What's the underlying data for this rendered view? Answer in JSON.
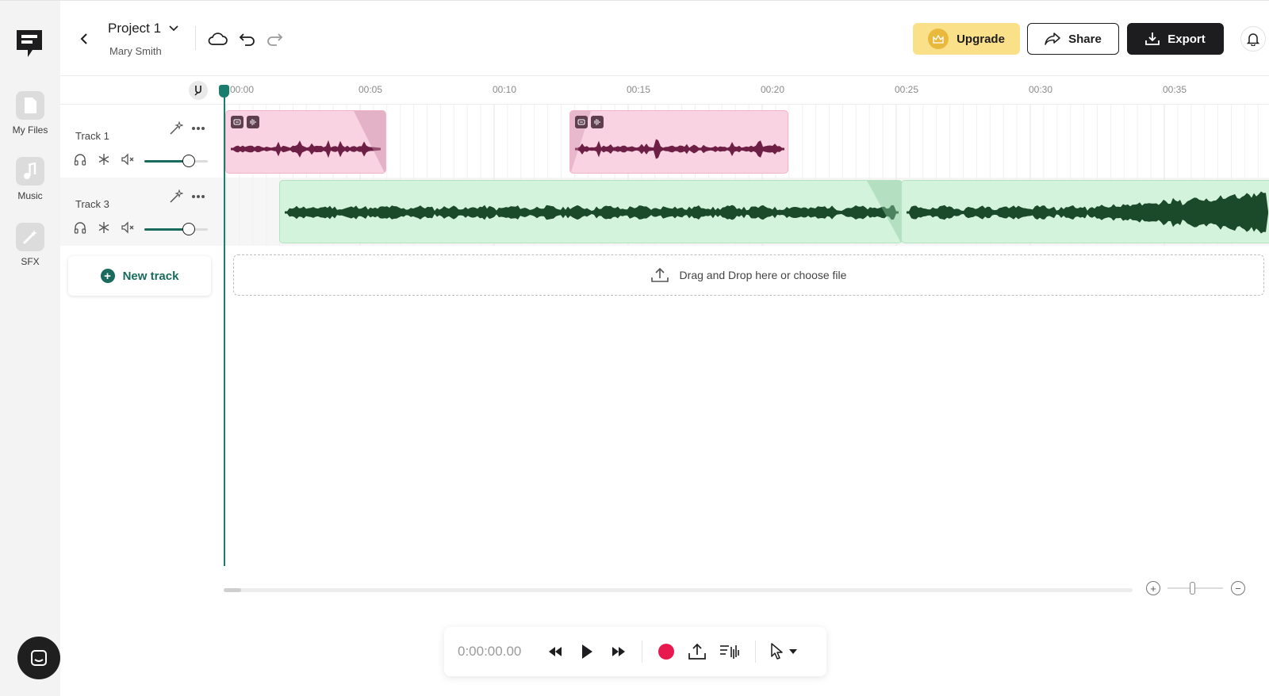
{
  "header": {
    "project_title": "Project 1",
    "user_name": "Mary Smith",
    "upgrade_label": "Upgrade",
    "share_label": "Share",
    "export_label": "Export"
  },
  "sidebar": {
    "items": [
      {
        "label": "My Files",
        "icon": "file-icon"
      },
      {
        "label": "Music",
        "icon": "music-note-icon"
      },
      {
        "label": "SFX",
        "icon": "magic-wand-icon"
      }
    ]
  },
  "ruler": {
    "ticks": [
      "00:00",
      "00:05",
      "00:10",
      "00:15",
      "00:20",
      "00:25",
      "00:30",
      "00:35"
    ]
  },
  "tracks": [
    {
      "name": "Track 1",
      "volume": 0.7,
      "clip_color": "#f9d3e2",
      "wave_color": "#6e1f45"
    },
    {
      "name": "Track 3",
      "volume": 0.7,
      "clip_color": "#d4f3dc",
      "wave_color": "#1b4a2a"
    }
  ],
  "new_track_label": "New track",
  "dropzone_text": "Drag and Drop here or choose file",
  "transport": {
    "time": "0:00:00.00"
  },
  "colors": {
    "accent": "#1a7d6e",
    "upgrade": "#fbe08a",
    "record": "#e8194f"
  }
}
